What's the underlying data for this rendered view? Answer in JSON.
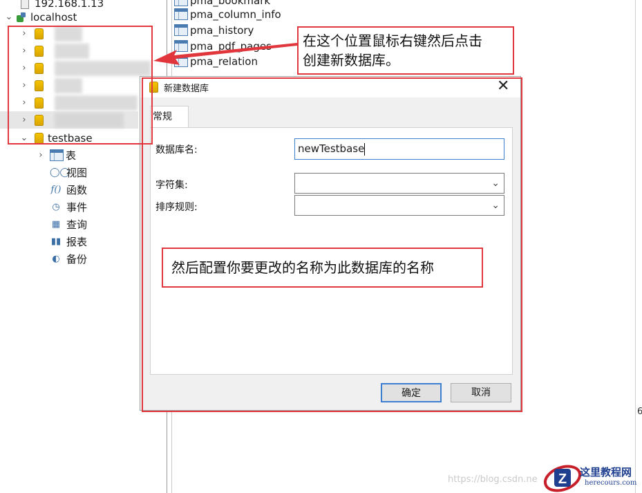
{
  "tree": {
    "ip_label": "192.168.1.13",
    "host_label": "localhost",
    "blurred_db_count": 6,
    "testbase_label": "testbase",
    "children": [
      {
        "icon": "table-icon",
        "label": "表",
        "expandable": true
      },
      {
        "icon": "view-icon",
        "label": "视图"
      },
      {
        "icon": "function-icon",
        "label": "函数"
      },
      {
        "icon": "event-icon",
        "label": "事件"
      },
      {
        "icon": "query-icon",
        "label": "查询"
      },
      {
        "icon": "report-icon",
        "label": "报表"
      },
      {
        "icon": "backup-icon",
        "label": "备份"
      }
    ]
  },
  "tables": [
    "pma_bookmark",
    "pma_column_info",
    "pma_history",
    "pma_pdf_pages",
    "pma_relation"
  ],
  "dialog": {
    "title": "新建数据库",
    "tab_general": "常规",
    "db_name_label": "数据库名:",
    "db_name_value": "newTestbase",
    "charset_label": "字符集:",
    "charset_value": "",
    "collation_label": "排序规则:",
    "collation_value": "",
    "ok_label": "确定",
    "cancel_label": "取消"
  },
  "annotations": {
    "top_note_line1": "在这个位置鼠标右键然后点击",
    "top_note_line2": "创建新数据库。",
    "middle_note": "然后配置你要更改的名称为此数据库的名称",
    "accent_color": "#e0363c"
  },
  "watermark": {
    "url": "https://blog.csdn.ne",
    "logo_title": "这里教程网",
    "logo_sub": "herecours.com"
  }
}
